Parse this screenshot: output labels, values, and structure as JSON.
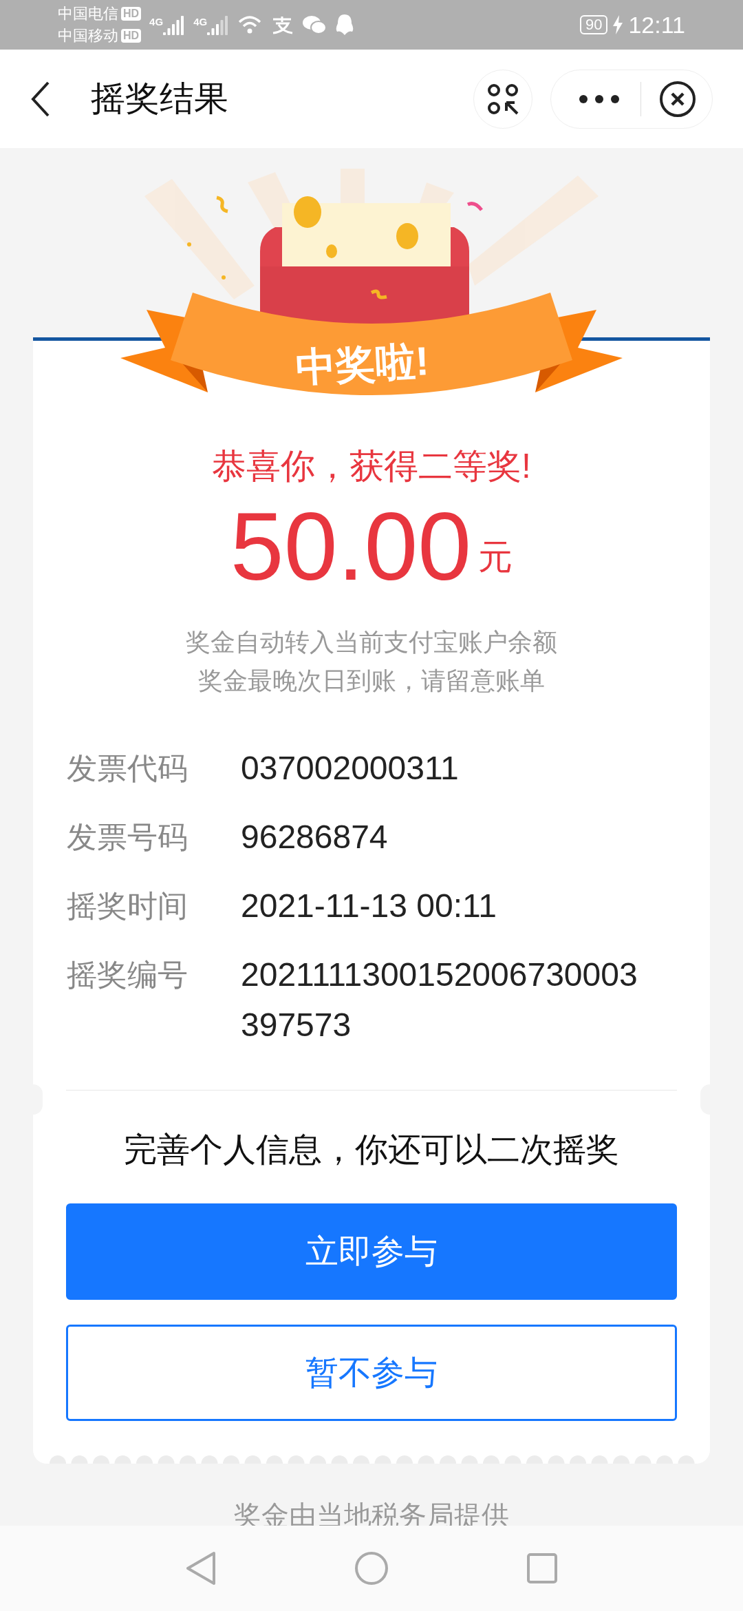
{
  "status_bar": {
    "carriers": [
      {
        "name": "中国电信",
        "badge": "HD"
      },
      {
        "name": "中国移动",
        "badge": "HD"
      }
    ],
    "network_labels": [
      "4G",
      "4G"
    ],
    "battery": "90",
    "time": "12:11"
  },
  "header": {
    "title": "摇奖结果"
  },
  "banner": {
    "ribbon_text": "中奖啦!"
  },
  "result": {
    "headline": "恭喜你，获得二等奖!",
    "amount": "50.00",
    "unit": "元",
    "notes": [
      "奖金自动转入当前支付宝账户余额",
      "奖金最晚次日到账，请留意账单"
    ]
  },
  "details": [
    {
      "label": "发票代码",
      "value": "037002000311"
    },
    {
      "label": "发票号码",
      "value": "96286874"
    },
    {
      "label": "摇奖时间",
      "value": "2021-11-13 00:11"
    },
    {
      "label": "摇奖编号",
      "value": "2021111300152006730003397573"
    }
  ],
  "second_chance": {
    "prompt": "完善个人信息，你还可以二次摇奖",
    "buttons": [
      {
        "label": "立即参与",
        "kind": "primary"
      },
      {
        "label": "暂不参与",
        "kind": "outline"
      }
    ]
  },
  "footer": {
    "text": "奖金由当地税务局提供"
  }
}
